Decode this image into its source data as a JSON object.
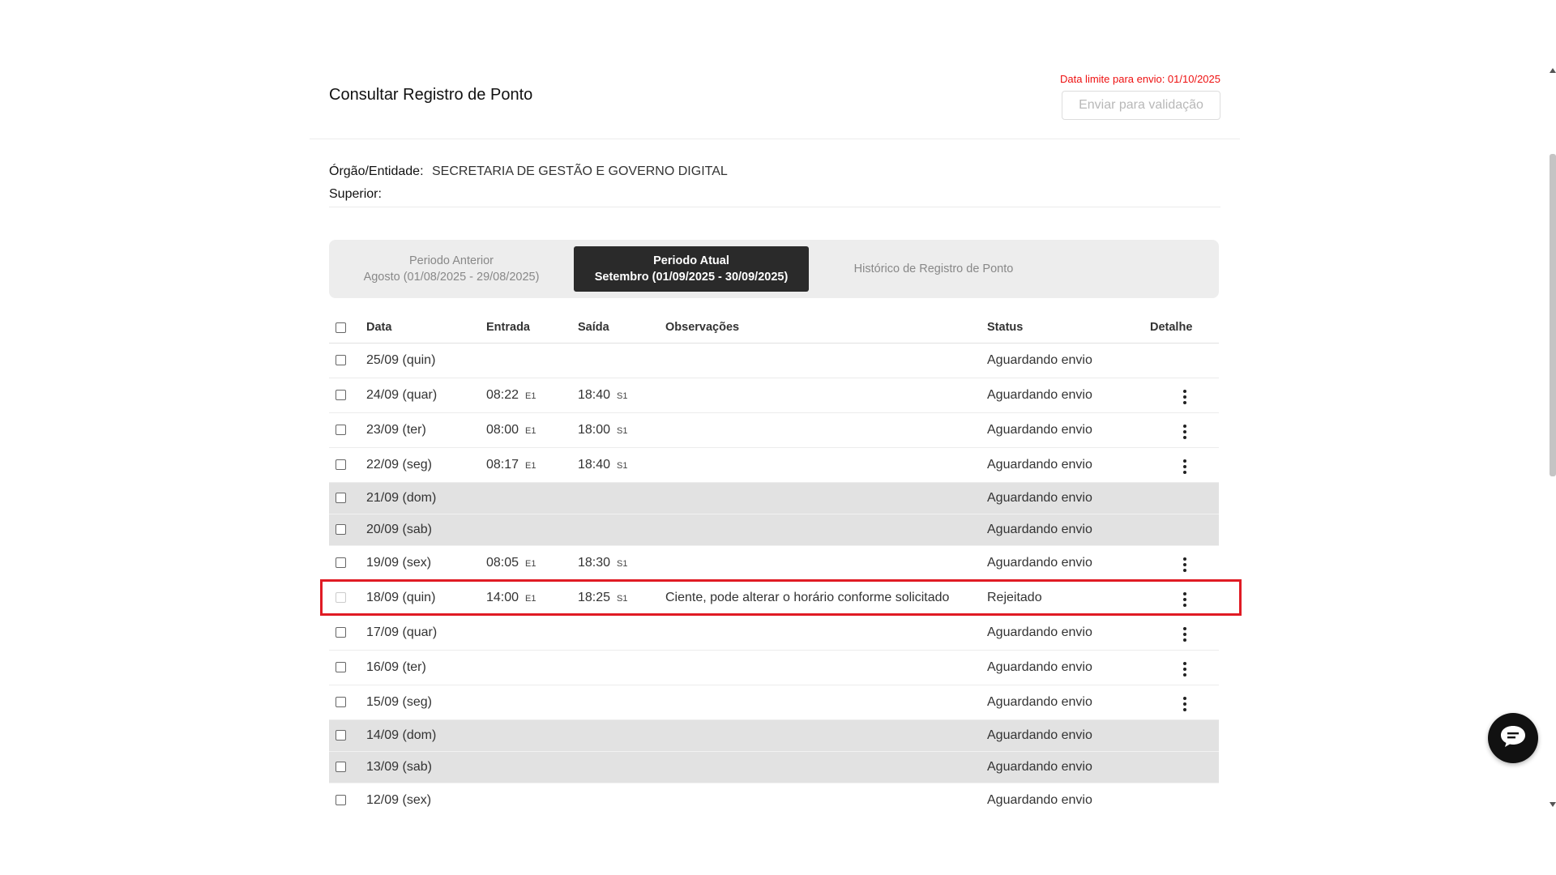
{
  "header": {
    "title": "Consultar Registro de Ponto",
    "deadline": "Data limite para envio: 01/10/2025",
    "send_button": "Enviar para validação"
  },
  "info": {
    "org_label": "Órgão/Entidade:",
    "org_value": "SECRETARIA DE GESTÃO E GOVERNO DIGITAL",
    "superior_label": "Superior:",
    "superior_value": ""
  },
  "periods": [
    {
      "line1": "Periodo Anterior",
      "line2": "Agosto (01/08/2025 - 29/08/2025)",
      "active": false
    },
    {
      "line1": "Periodo Atual",
      "line2": "Setembro (01/09/2025 - 30/09/2025)",
      "active": true
    },
    {
      "line1": "Histórico de Registro de Ponto",
      "line2": "",
      "active": false
    }
  ],
  "table": {
    "headers": {
      "data": "Data",
      "entrada": "Entrada",
      "saida": "Saída",
      "observacoes": "Observações",
      "status": "Status",
      "detalhe": "Detalhe"
    },
    "rows": [
      {
        "data": "25/09 (quin)",
        "entrada": "",
        "entrada_tag": "",
        "saida": "",
        "saida_tag": "",
        "obs": "",
        "status": "Aguardando envio",
        "detail": false,
        "weekend": false
      },
      {
        "data": "24/09 (quar)",
        "entrada": "08:22",
        "entrada_tag": "E1",
        "saida": "18:40",
        "saida_tag": "S1",
        "obs": "",
        "status": "Aguardando envio",
        "detail": true,
        "weekend": false
      },
      {
        "data": "23/09 (ter)",
        "entrada": "08:00",
        "entrada_tag": "E1",
        "saida": "18:00",
        "saida_tag": "S1",
        "obs": "",
        "status": "Aguardando envio",
        "detail": true,
        "weekend": false
      },
      {
        "data": "22/09 (seg)",
        "entrada": "08:17",
        "entrada_tag": "E1",
        "saida": "18:40",
        "saida_tag": "S1",
        "obs": "",
        "status": "Aguardando envio",
        "detail": true,
        "weekend": false
      },
      {
        "data": "21/09 (dom)",
        "entrada": "",
        "entrada_tag": "",
        "saida": "",
        "saida_tag": "",
        "obs": "",
        "status": "Aguardando envio",
        "detail": false,
        "weekend": true
      },
      {
        "data": "20/09 (sab)",
        "entrada": "",
        "entrada_tag": "",
        "saida": "",
        "saida_tag": "",
        "obs": "",
        "status": "Aguardando envio",
        "detail": false,
        "weekend": true
      },
      {
        "data": "19/09 (sex)",
        "entrada": "08:05",
        "entrada_tag": "E1",
        "saida": "18:30",
        "saida_tag": "S1",
        "obs": "",
        "status": "Aguardando envio",
        "detail": true,
        "weekend": false
      },
      {
        "data": "18/09 (quin)",
        "entrada": "14:00",
        "entrada_tag": "E1",
        "saida": "18:25",
        "saida_tag": "S1",
        "obs": "Ciente, pode alterar o horário conforme solicitado",
        "status": "Rejeitado",
        "detail": true,
        "weekend": false,
        "disabled": true
      },
      {
        "data": "17/09 (quar)",
        "entrada": "",
        "entrada_tag": "",
        "saida": "",
        "saida_tag": "",
        "obs": "",
        "status": "Aguardando envio",
        "detail": true,
        "weekend": false
      },
      {
        "data": "16/09 (ter)",
        "entrada": "",
        "entrada_tag": "",
        "saida": "",
        "saida_tag": "",
        "obs": "",
        "status": "Aguardando envio",
        "detail": true,
        "weekend": false
      },
      {
        "data": "15/09 (seg)",
        "entrada": "",
        "entrada_tag": "",
        "saida": "",
        "saida_tag": "",
        "obs": "",
        "status": "Aguardando envio",
        "detail": true,
        "weekend": false
      },
      {
        "data": "14/09 (dom)",
        "entrada": "",
        "entrada_tag": "",
        "saida": "",
        "saida_tag": "",
        "obs": "",
        "status": "Aguardando envio",
        "detail": false,
        "weekend": true
      },
      {
        "data": "13/09 (sab)",
        "entrada": "",
        "entrada_tag": "",
        "saida": "",
        "saida_tag": "",
        "obs": "",
        "status": "Aguardando envio",
        "detail": false,
        "weekend": true
      },
      {
        "data": "12/09 (sex)",
        "entrada": "",
        "entrada_tag": "",
        "saida": "",
        "saida_tag": "",
        "obs": "",
        "status": "Aguardando envio",
        "detail": false,
        "weekend": false
      }
    ]
  },
  "icons": {
    "chat": "chat-bubble-icon",
    "detail": "more-vertical-icon"
  },
  "colors": {
    "deadline": "#e11111",
    "active_tab": "#2a2a2a",
    "highlight": "#e01b24"
  }
}
